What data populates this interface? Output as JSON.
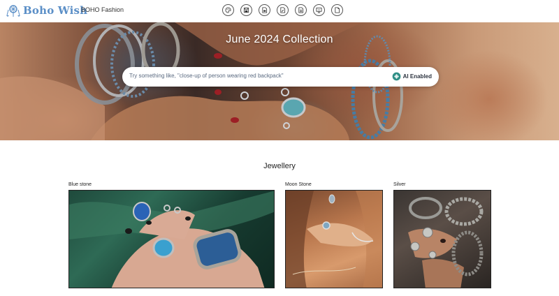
{
  "header": {
    "logo_text": "Boho Wish",
    "subtitle": "BOHO Fashion",
    "nav_icons": [
      {
        "icon": "palette-icon"
      },
      {
        "icon": "save-icon"
      },
      {
        "icon": "document-save-icon"
      },
      {
        "icon": "document-edit-icon"
      },
      {
        "icon": "document-list-icon"
      },
      {
        "icon": "monitor-icon"
      },
      {
        "icon": "file-icon"
      }
    ]
  },
  "hero": {
    "title": "June 2024 Collection",
    "search": {
      "placeholder": "Try something like, \"close-up of person wearing red backpack\"",
      "value": ""
    },
    "ai_badge": "AI Enabled"
  },
  "section": {
    "title": "Jewellery",
    "cards": [
      {
        "label": "Blue stone"
      },
      {
        "label": "Moon Stone"
      },
      {
        "label": "Silver"
      }
    ]
  },
  "colors": {
    "logo": "#5b8fc7",
    "ai_icon": "#2f8f86"
  }
}
